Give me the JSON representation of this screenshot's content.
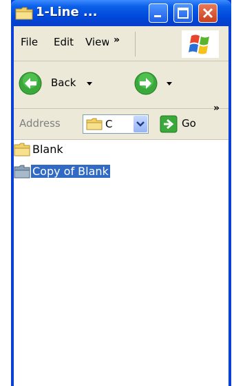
{
  "window": {
    "title": "1-Line ...",
    "buttons": {
      "minimize": "minimize",
      "maximize": "maximize",
      "close": "close"
    }
  },
  "menubar": {
    "items": [
      "File",
      "Edit",
      "View"
    ],
    "overflow": "»"
  },
  "toolbar": {
    "back_label": "Back",
    "overflow": "»"
  },
  "addressbar": {
    "label": "Address",
    "value": "C",
    "go_label": "Go"
  },
  "files": [
    {
      "name": "Blank",
      "selected": false
    },
    {
      "name": "Copy of Blank",
      "selected": true
    }
  ],
  "colors": {
    "title_blue": "#0046d8",
    "selection": "#316ac5",
    "close_red": "#c8401e",
    "client_bg": "#ece9d8"
  }
}
